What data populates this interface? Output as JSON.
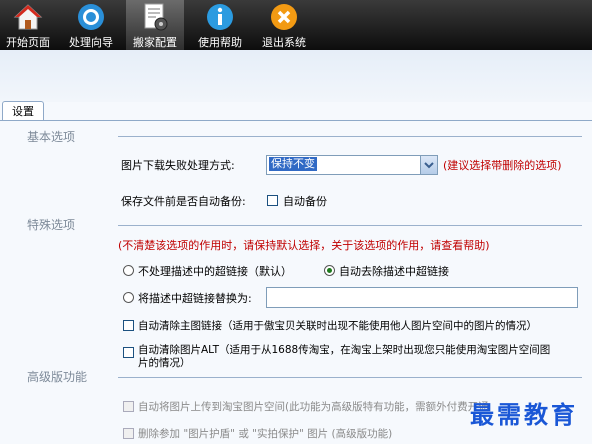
{
  "toolbar": {
    "items": [
      {
        "label": "开始页面",
        "icon": "home-icon"
      },
      {
        "label": "处理向导",
        "icon": "wizard-icon"
      },
      {
        "label": "搬家配置",
        "icon": "config-doc-icon"
      },
      {
        "label": "使用帮助",
        "icon": "info-icon"
      },
      {
        "label": "退出系统",
        "icon": "exit-icon"
      }
    ],
    "active_index": 2
  },
  "tab": {
    "label": "设置"
  },
  "basic": {
    "title": "基本选项",
    "image_fail_label": "图片下载失败处理方式:",
    "image_fail_value": "保持不变",
    "image_fail_hint": "(建议选择带删除的选项)",
    "backup_label": "保存文件前是否自动备份:",
    "backup_checkbox": "自动备份",
    "backup_checked": false
  },
  "special": {
    "title": "特殊选项",
    "note": "(不清楚该选项的作用时，请保持默认选择，关于该选项的作用，请查看帮助)",
    "radio_keep": "不处理描述中的超链接（默认）",
    "radio_remove": "自动去除描述中超链接",
    "radio_replace": "将描述中超链接替换为:",
    "replace_value": "",
    "selected_radio": "radio_remove",
    "cb_main_link": "自动清除主图链接（适用于傲宝贝关联时出现不能使用他人图片空间中的图片的情况）",
    "cb_alt_line1": "自动清除图片ALT（适用于从1688传淘宝，在淘宝上架时出现您只能使用淘宝图片空间图",
    "cb_alt_line2": "片的情况）"
  },
  "advanced": {
    "title": "高级版功能",
    "cb_upload": "自动将图片上传到淘宝图片空间(此功能为高级版特有功能，需额外付费开通",
    "cb_delete": "删除参加 \"图片护盾\" 或 \"实拍保护\" 图片 (高级版功能)"
  },
  "watermark": "最需教育",
  "colors": {
    "accent_red": "#c00000",
    "selection_blue": "#316ac5",
    "line": "#9bb1cc"
  }
}
